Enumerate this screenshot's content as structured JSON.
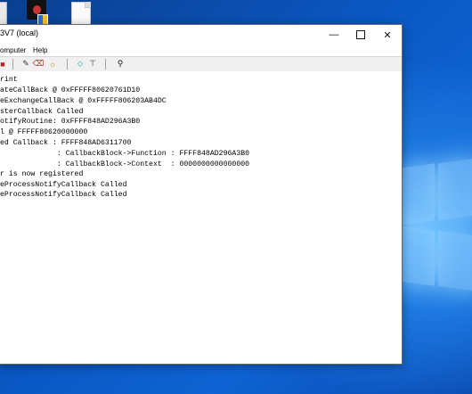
{
  "window": {
    "title": "3V7 (local)",
    "minimize_glyph": "—",
    "close_glyph": "✕"
  },
  "menu": [
    {
      "label": "omputer"
    },
    {
      "label": "Help"
    }
  ],
  "toolbar": {
    "icons": [
      "stop-icon",
      "edit-icon",
      "delete-icon",
      "bug-icon",
      "connect-icon",
      "disconnect-icon",
      "find-icon"
    ],
    "glyphs": {
      "stop": "■",
      "edit": "✎",
      "delete": "⌫",
      "bug": "☼",
      "connect": "⬦",
      "disconnect": "⊤",
      "find": "⚲"
    }
  },
  "log": {
    "lines": [
      "rint",
      "ateCallBack @ 0xFFFFF80620761D10",
      "eExchangeCallBack @ 0xFFFFF806203AB4DC",
      "sterCallback Called",
      "otifyRoutine: 0xFFFF848AD296A3B0",
      "l @ FFFFF80620000000",
      "ed Callback : FFFF848AD6311700",
      "             : CallbackBlock->Function : FFFF848AD296A3B0",
      "             : CallbackBlock->Context  : 0000000000000000",
      "r is now registered",
      "eProcessNotifyCallback Called",
      "eProcessNotifyCallback Called"
    ]
  }
}
